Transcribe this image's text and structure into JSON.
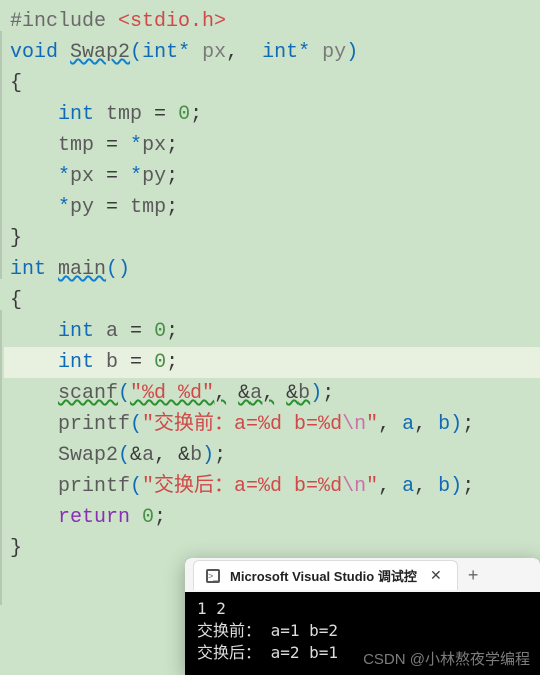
{
  "code": {
    "l1_preproc": "#include",
    "l1_lt": " <",
    "l1_header": "stdio.h",
    "l1_gt": ">",
    "l2_void": "void",
    "l2_func": "Swap2",
    "l2_int1": "int",
    "l2_star1": "*",
    "l2_p1": " px",
    "l2_comma": ",",
    "l2_int2": "int",
    "l2_star2": "*",
    "l2_p2": " py",
    "l3_brace": "{",
    "l4_int": "int",
    "l4_var": " tmp ",
    "l4_eq": "=",
    "l4_zero": " 0",
    "l5_lhs": "tmp ",
    "l5_eq": "=",
    "l5_star": " *",
    "l5_rhs": "px",
    "l6_star1": "*",
    "l6_lhs": "px ",
    "l6_eq": "=",
    "l6_star2": " *",
    "l6_rhs": "py",
    "l7_star": "*",
    "l7_lhs": "py ",
    "l7_eq": "=",
    "l7_rhs": " tmp",
    "l8_brace": "}",
    "l9_int": "int",
    "l9_func": "main",
    "l10_brace": "{",
    "l11_int": "int",
    "l11_var": " a ",
    "l11_eq": "=",
    "l11_zero": " 0",
    "l12_int": "int",
    "l12_var": " b ",
    "l12_eq": "=",
    "l12_zero": " 0",
    "l13_func": "scanf",
    "l13_str": "\"%d %d\"",
    "l13_a1": "a",
    "l13_a2": "b",
    "l14_func": "printf",
    "l14_str1": "\"交换前：a=%d b=%d",
    "l14_esc": "\\n",
    "l14_str2": "\"",
    "l14_a1": " a",
    "l14_a2": " b",
    "l15_func": "Swap2",
    "l15_a1": "a",
    "l15_a2": "b",
    "l16_func": "printf",
    "l16_str1": "\"交换后：a=%d b=%d",
    "l16_esc": "\\n",
    "l16_str2": "\"",
    "l16_a1": " a",
    "l16_a2": " b",
    "l17_return": "return",
    "l17_zero": " 0",
    "l18_brace": "}"
  },
  "console": {
    "tab_title": "Microsoft Visual Studio 调试控",
    "line1": "1 2",
    "line2": "交换前： a=1 b=2",
    "line3": "交换后： a=2 b=1"
  },
  "watermark": "CSDN @小林熬夜学编程"
}
